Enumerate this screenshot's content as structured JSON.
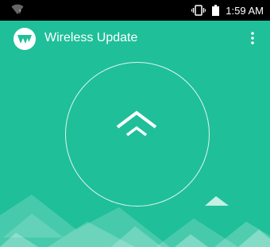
{
  "status_bar": {
    "time": "1:59 AM",
    "icons": [
      "wifi-icon",
      "vibrate-icon",
      "battery-icon"
    ]
  },
  "app_bar": {
    "title": "Wireless Update",
    "logo": "app-logo-icon",
    "menu": "overflow-menu-icon"
  },
  "main": {
    "action_icon": "double-chevron-up-icon"
  },
  "colors": {
    "background": "#1fbf99",
    "status_bar": "#000000",
    "foreground": "#ffffff"
  }
}
